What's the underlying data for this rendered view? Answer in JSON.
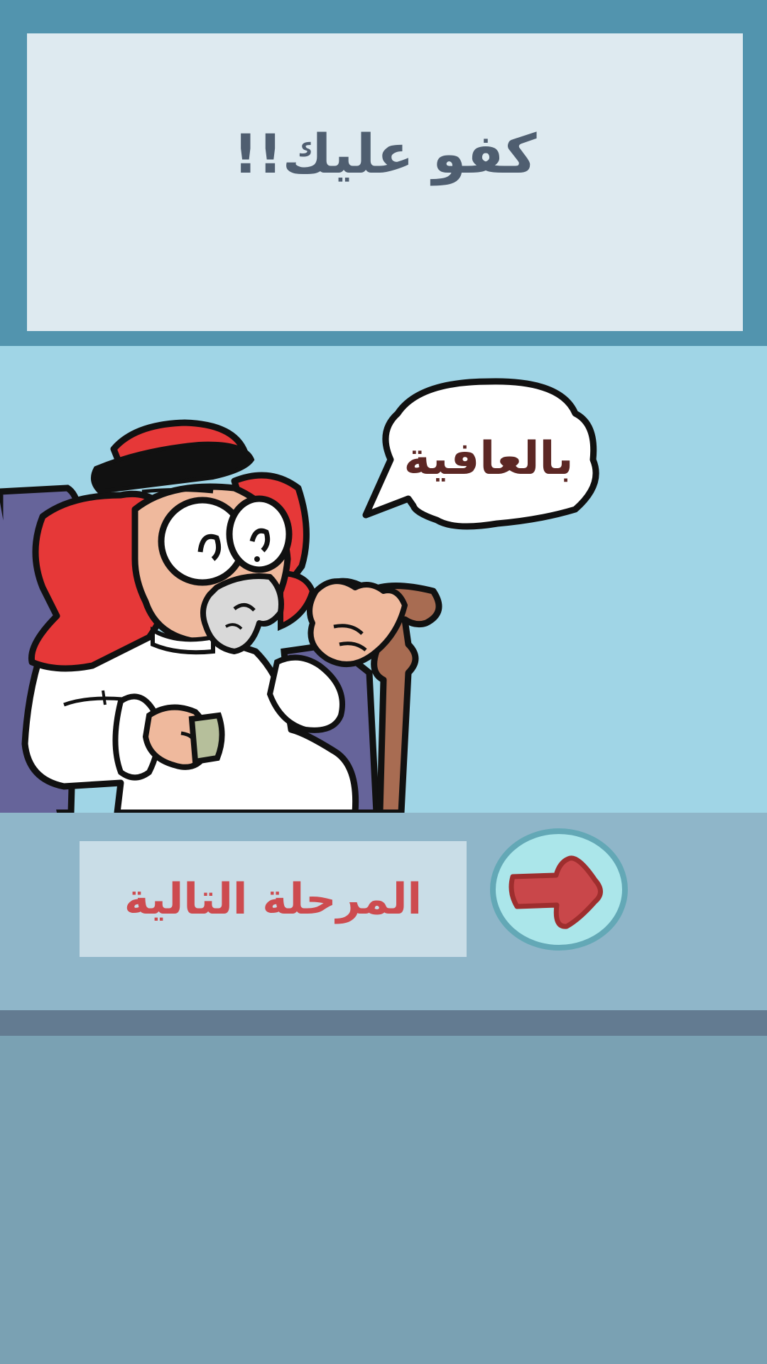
{
  "header": {
    "message": "كفو عليك!!"
  },
  "scene": {
    "speech_bubble": "بالعافية",
    "character": "old-man-with-cane-and-coffee-cup"
  },
  "controls": {
    "next_stage_label": "المرحلة التالية",
    "next_arrow_icon": "arrow-right-icon"
  },
  "colors": {
    "top_band": "#5294ae",
    "title_panel": "#deeaf0",
    "title_text": "#4f5e70",
    "scene_bg": "#a0d5e6",
    "bottom_band": "#8fb6c9",
    "next_button": "#c9dde7",
    "next_text": "#cd4b4f",
    "arrow_fill": "#c9474a",
    "arrow_circle": "#abe6ea",
    "divider": "#637b91",
    "lower_area": "#7aa1b3"
  }
}
